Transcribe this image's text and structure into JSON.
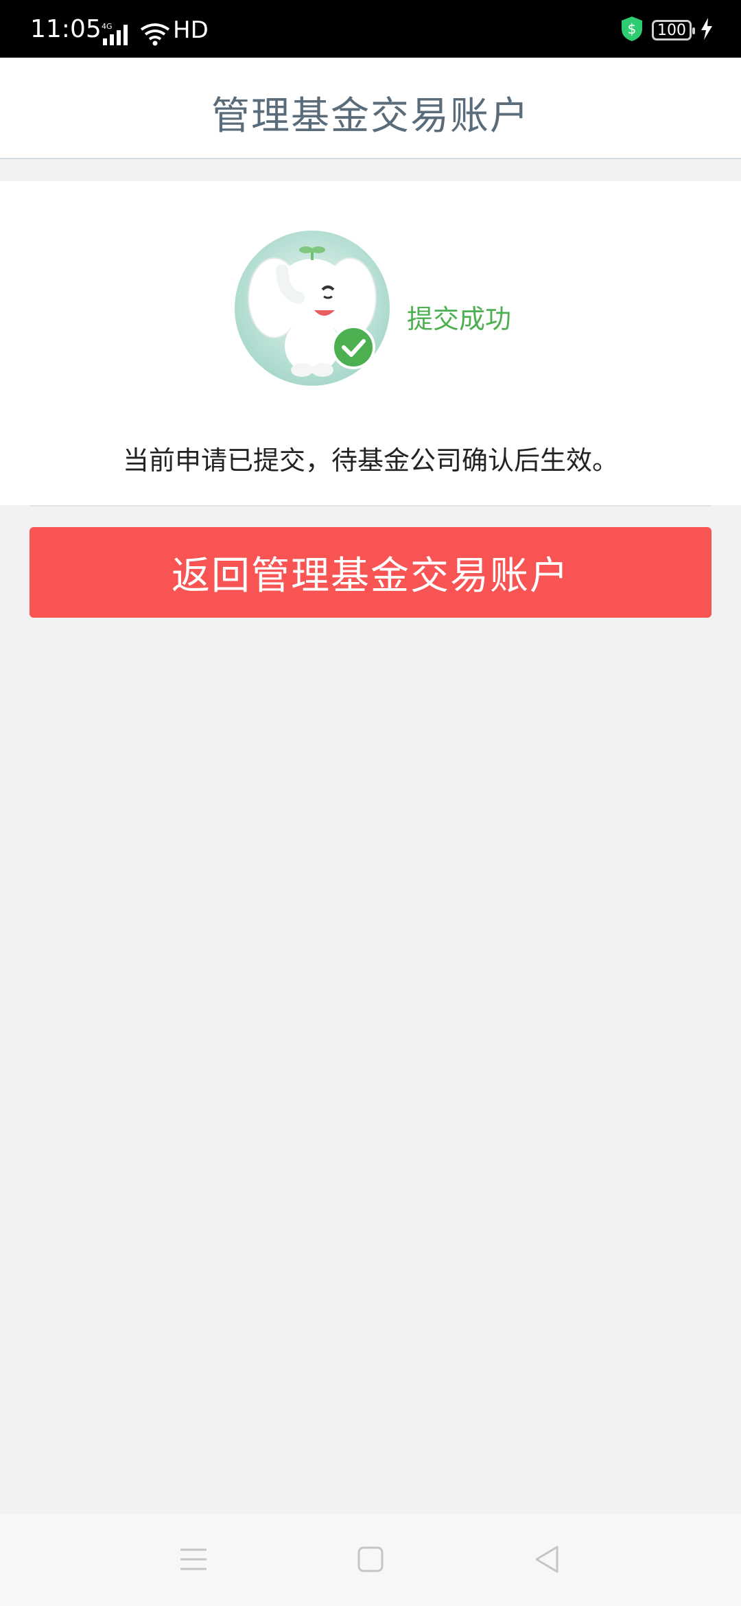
{
  "status_bar": {
    "time": "11:05",
    "network": "4G",
    "hd": "HD",
    "battery": "100"
  },
  "header": {
    "title": "管理基金交易账户"
  },
  "result": {
    "status_label": "提交成功",
    "message": "当前申请已提交，待基金公司确认后生效。"
  },
  "actions": {
    "return_label": "返回管理基金交易账户"
  },
  "colors": {
    "accent_red": "#f85454",
    "success_green": "#4caf50",
    "title_gray": "#5a6b7a"
  },
  "nav": {
    "menu_icon": "menu-icon",
    "home_icon": "home-icon",
    "back_icon": "back-icon"
  }
}
